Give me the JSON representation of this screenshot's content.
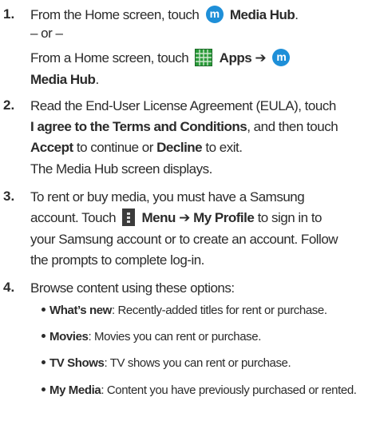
{
  "steps": [
    {
      "num": "1.",
      "line1_pre": "From the Home screen, touch",
      "line1_bold": "Media Hub",
      "line1_post": ".",
      "or": "– or –",
      "line3_pre": "From a Home screen, touch",
      "line3_bold": "Apps ➔",
      "line4_bold": "Media Hub",
      "line4_post": "."
    },
    {
      "num": "2.",
      "line1": "Read the End-User License Agreement (EULA), touch",
      "line2_bold": "I agree to the Terms and Conditions",
      "line2_post": ", and then touch",
      "line3_bold1": "Accept",
      "line3_mid": " to continue or ",
      "line3_bold2": "Decline",
      "line3_post": " to exit.",
      "line4": "The Media Hub screen displays."
    },
    {
      "num": "3.",
      "line1": "To rent or buy media, you must have a Samsung",
      "line2_pre": "account. Touch",
      "line2_bold": "Menu ➔ My Profile",
      "line2_post": " to sign in to",
      "line3": "your Samsung account or to create an account. Follow",
      "line4": "the prompts to complete log-in."
    },
    {
      "num": "4.",
      "line1": "Browse content using these options:"
    }
  ],
  "options": [
    {
      "label": "What’s new",
      "desc": ": Recently-added titles for rent or purchase."
    },
    {
      "label": "Movies",
      "desc": ": Movies you can rent or purchase."
    },
    {
      "label": "TV Shows",
      "desc": ": TV shows you can rent or purchase."
    },
    {
      "label": "My Media",
      "desc": ": Content you have previously purchased or rented."
    }
  ],
  "icons": {
    "media_hub": "media-hub-icon",
    "apps": "apps-icon",
    "menu": "menu-icon",
    "media_hub_glyph": "m"
  }
}
